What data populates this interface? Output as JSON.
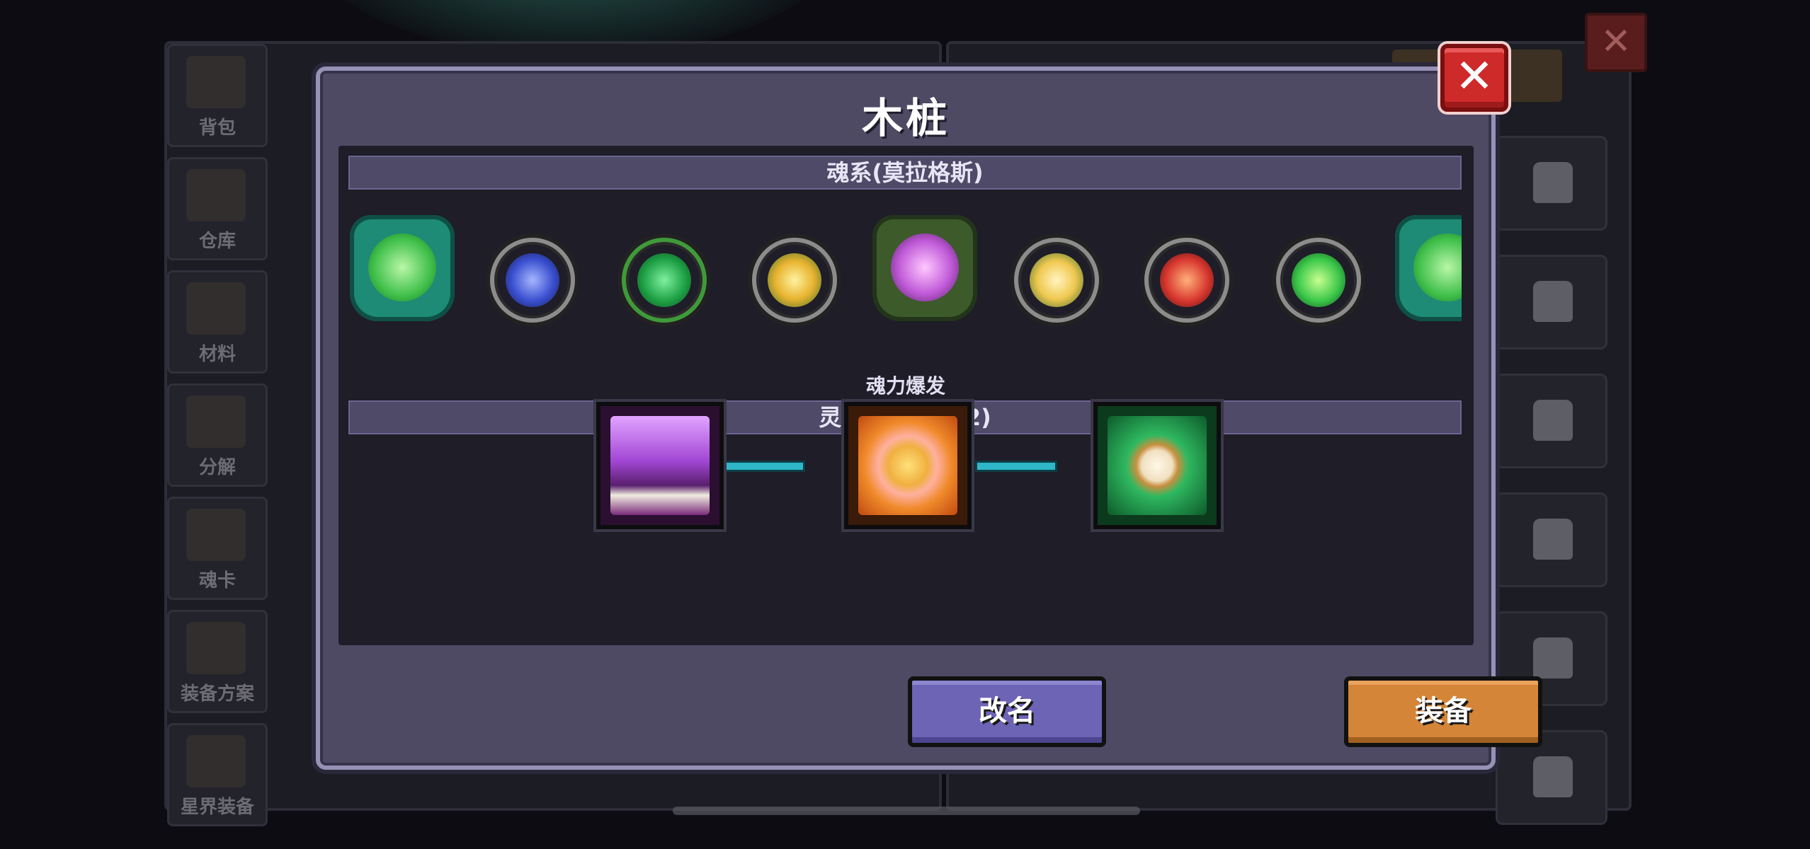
{
  "background": {
    "sidebar_items": [
      {
        "label": "背包"
      },
      {
        "label": "仓库"
      },
      {
        "label": "材料"
      },
      {
        "label": "分解"
      },
      {
        "label": "魂卡"
      },
      {
        "label": "装备方案"
      },
      {
        "label": "星界装备"
      }
    ],
    "close_glyph": "✕"
  },
  "dialog": {
    "title": "木桩",
    "close_glyph": "✕",
    "soul_section": {
      "header": "魂系(莫拉格斯)",
      "souls": [
        {
          "icon": "crossed-blades-soul-icon",
          "color": "#6fe07a"
        },
        {
          "icon": "blue-rune-soul-icon",
          "color": "#3a5fd8"
        },
        {
          "icon": "green-serpent-soul-icon",
          "color": "#2dbb5a"
        },
        {
          "icon": "golden-flame-soul-icon",
          "color": "#e8b430"
        },
        {
          "icon": "purple-crystal-soul-icon",
          "color": "#c05ad8"
        },
        {
          "icon": "golden-wing-soul-icon",
          "color": "#f0c850"
        },
        {
          "icon": "crimson-sword-soul-icon",
          "color": "#d8382f"
        },
        {
          "icon": "green-key-soul-icon",
          "color": "#3cc84a"
        },
        {
          "icon": "crossed-staffs-soul-icon",
          "color": "#6fe07a"
        }
      ]
    },
    "link_section": {
      "header": "灵魂连接(页签2)",
      "center_label": "魂力爆发",
      "skills": [
        {
          "icon": "purple-flame-book-icon",
          "color": "#a347d6"
        },
        {
          "icon": "golden-shield-burst-icon",
          "color": "#f08a2a"
        },
        {
          "icon": "green-stopwatch-icon",
          "color": "#2fb860"
        }
      ],
      "connector_color": "#2fb7c9"
    },
    "buttons": {
      "rename": "改名",
      "equip": "装备"
    }
  }
}
